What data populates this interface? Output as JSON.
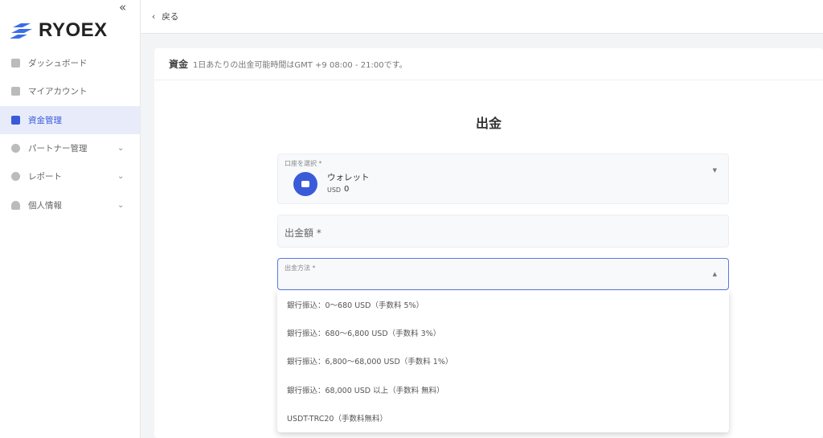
{
  "sidebar": {
    "brand": "RYOEX",
    "items": [
      {
        "label": "ダッシュボード",
        "icon": "dashboard-icon"
      },
      {
        "label": "マイアカウント",
        "icon": "accounts-icon"
      },
      {
        "label": "資金管理",
        "icon": "wallet-icon",
        "active": true
      },
      {
        "label": "パートナー管理",
        "icon": "partner-icon",
        "expandable": true
      },
      {
        "label": "レポート",
        "icon": "report-icon",
        "expandable": true
      },
      {
        "label": "個人情報",
        "icon": "user-icon",
        "expandable": true
      }
    ]
  },
  "topbar": {
    "back_label": "戻る"
  },
  "card": {
    "heading": "資金",
    "notice": "1日あたりの出金可能時間はGMT +9 08:00 - 21:00です。"
  },
  "form": {
    "title": "出金",
    "account": {
      "label": "口座を選択 *",
      "name": "ウォレット",
      "currency": "USD",
      "balance": "0"
    },
    "amount": {
      "placeholder": "出金額 *"
    },
    "method": {
      "label": "出金方法 *",
      "options": [
        "銀行振込：0〜680 USD（手数料 5%）",
        "銀行振込：680〜6,800 USD（手数料 3%）",
        "銀行振込：6,800〜68,000 USD（手数料 1%）",
        "銀行振込：68,000 USD 以上（手数料 無料）",
        "USDT-TRC20（手数料無料）"
      ]
    }
  },
  "colors": {
    "accent": "#3a5bd9",
    "active_bg": "#e8ecfa"
  }
}
